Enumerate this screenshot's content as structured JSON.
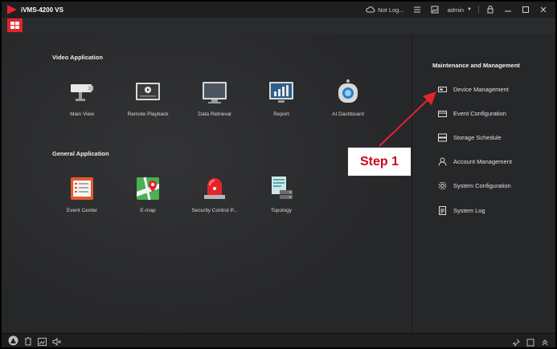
{
  "app": {
    "title": "iVMS-4200 VS"
  },
  "titlebar": {
    "cloud_status": "Not Log...",
    "user": "admin"
  },
  "video_application": {
    "title": "Video Application",
    "items": [
      {
        "label": "Main View",
        "icon": "camera-icon"
      },
      {
        "label": "Remote Playback",
        "icon": "playback-icon"
      },
      {
        "label": "Data Retrieval",
        "icon": "monitor-icon"
      },
      {
        "label": "Report",
        "icon": "report-icon"
      },
      {
        "label": "AI Dashboard",
        "icon": "robot-icon"
      }
    ]
  },
  "general_application": {
    "title": "General Application",
    "items": [
      {
        "label": "Event Center",
        "icon": "event-center-icon"
      },
      {
        "label": "E-map",
        "icon": "map-icon"
      },
      {
        "label": "Security Control P...",
        "icon": "alarm-light-icon"
      },
      {
        "label": "Topology",
        "icon": "topology-icon"
      }
    ]
  },
  "maintenance": {
    "title": "Maintenance and Management",
    "items": [
      {
        "label": "Device Management",
        "icon": "device-icon"
      },
      {
        "label": "Event Configuration",
        "icon": "event-config-icon"
      },
      {
        "label": "Storage Schedule",
        "icon": "storage-icon"
      },
      {
        "label": "Account Management",
        "icon": "account-icon"
      },
      {
        "label": "System Configuration",
        "icon": "gear-icon"
      },
      {
        "label": "System Log",
        "icon": "log-icon"
      }
    ]
  },
  "annotation": {
    "label": "Step 1",
    "color": "#d0021b"
  },
  "colors": {
    "accent": "#e3242b",
    "background": "#2a2b2d",
    "annotation_red": "#d0021b"
  }
}
